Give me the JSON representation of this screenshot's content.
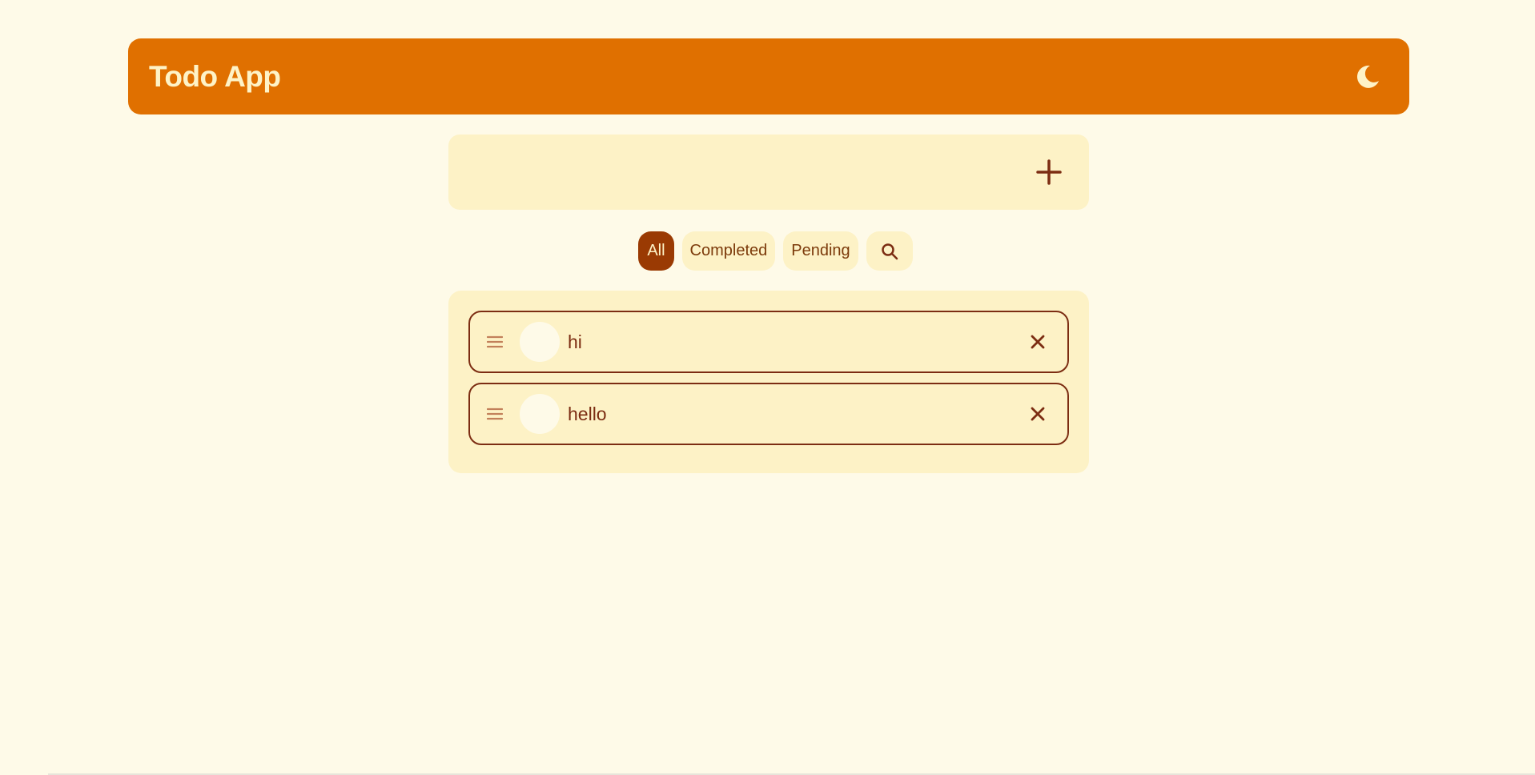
{
  "header": {
    "title": "Todo App",
    "theme_icon": "moon-icon"
  },
  "add_todo": {
    "placeholder": "",
    "value": "",
    "add_icon": "plus-icon"
  },
  "filters": {
    "items": [
      {
        "label": "All",
        "active": true
      },
      {
        "label": "Completed",
        "active": false
      },
      {
        "label": "Pending",
        "active": false
      }
    ],
    "search_icon": "search-icon"
  },
  "todos": [
    {
      "text": "hi",
      "completed": false
    },
    {
      "text": "hello",
      "completed": false
    }
  ],
  "colors": {
    "background": "#fefae8",
    "header": "#e07000",
    "panel": "#fdf2c6",
    "accent": "#9a3a03",
    "text": "#7c2d12"
  }
}
